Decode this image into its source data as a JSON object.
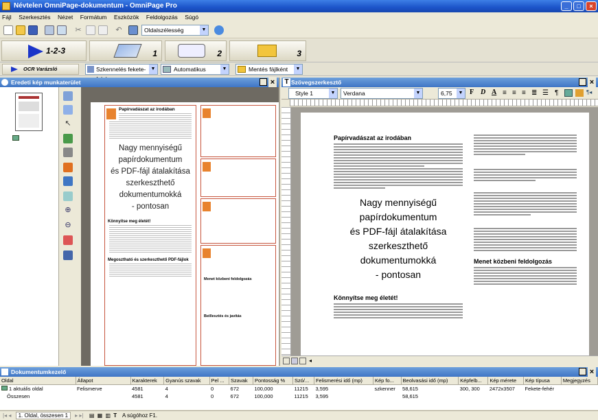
{
  "window": {
    "title": "Névtelen OmniPage-dokumentum - OmniPage Pro",
    "minimize": "_",
    "maximize": "□",
    "close": "×"
  },
  "menu": [
    "Fájl",
    "Szerkesztés",
    "Nézet",
    "Formátum",
    "Eszközök",
    "Feldolgozás",
    "Súgó"
  ],
  "toolbar": {
    "page_view_label": "Oldalszélesség"
  },
  "big_buttons": [
    {
      "label": "1-2-3"
    },
    {
      "label": "1"
    },
    {
      "label": "2"
    },
    {
      "label": "3"
    }
  ],
  "toolbar2": {
    "ocr_wizard": "OCR Varázsló",
    "scan_source": "Szkennelés fekete-fehér",
    "layout": "Automatikus",
    "save": "Mentés fájlként"
  },
  "left_panel": {
    "title": "Eredeti kép munkaterület"
  },
  "right_panel": {
    "title": "Szövegszerkesztő",
    "style": "Style 1",
    "font": "Verdana",
    "size": "6,75",
    "bold": "F",
    "italic": "D",
    "underline": "A"
  },
  "document": {
    "heading1": "Papírvadászat az irodában",
    "big_text": [
      "Nagy mennyiségű",
      "papírdokumentum",
      "és PDF-fájl átalakítása",
      "szerkeszthető",
      "dokumentumokká",
      "- pontosan"
    ],
    "heading2": "Könnyítse meg életét!",
    "heading3": "Menet közbeni feldolgozás",
    "original_h1": "Papírvadászat az irodában",
    "original_h2": "Könnyítse meg életét!",
    "original_h3": "Megosztható és szerkeszthető PDF-fájlok",
    "original_h4": "Menet közbeni feldolgozás",
    "original_h5": "Beillesztés és javítás"
  },
  "bottom_panel": {
    "title": "Dokumentumkezelő",
    "columns": [
      "Oldal",
      "Állapot",
      "Karakterek",
      "Gyanús szavak",
      "Pel ...",
      "Szavak",
      "Pontosság %",
      "Szó/...",
      "Felismerési idő (mp)",
      "Kép fo...",
      "Beolvasási idő (mp)",
      "Képfelb...",
      "Kép mérete",
      "Kép típusa",
      "Megjegyzés"
    ],
    "rows": [
      [
        "1 aktuális oldal",
        "Felismerve",
        "4581",
        "4",
        "0",
        "672",
        "100,000",
        "11215",
        "3,595",
        "szkenner",
        "58,615",
        "300, 300",
        "2472x3507",
        "Fekete-fehér",
        ""
      ],
      [
        "Összesen",
        "",
        "4581",
        "4",
        "0",
        "672",
        "100,000",
        "11215",
        "3,595",
        "",
        "58,615",
        "",
        "",
        "",
        ""
      ]
    ]
  },
  "status": {
    "page_info": "1. Oldal, összesen 1",
    "help": "A súgóhoz F1."
  }
}
